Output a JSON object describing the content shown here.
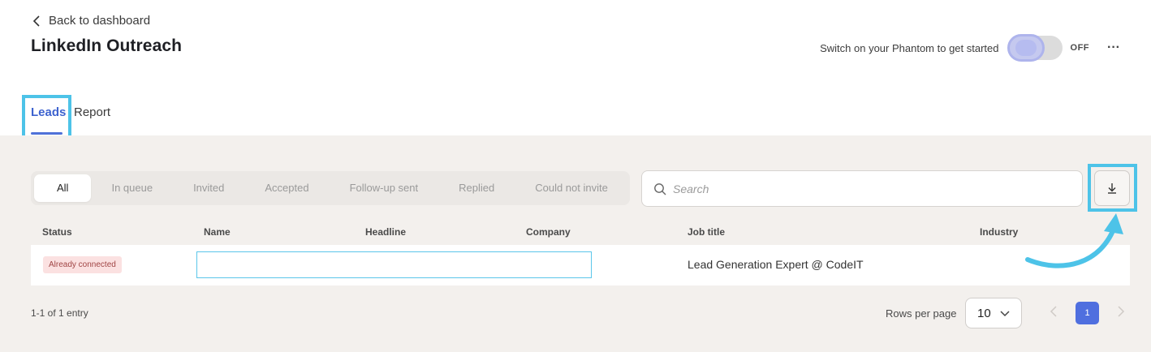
{
  "header": {
    "back_label": "Back to dashboard",
    "title": "LinkedIn Outreach",
    "switch_text": "Switch on your Phantom to get started",
    "toggle_state": "OFF",
    "more_icon": "more-horizontal-icon",
    "more_label": "···"
  },
  "tabs": [
    {
      "label": "Leads",
      "active": true
    },
    {
      "label": "Report",
      "active": false
    }
  ],
  "filters": [
    {
      "label": "All",
      "active": true
    },
    {
      "label": "In queue",
      "active": false
    },
    {
      "label": "Invited",
      "active": false
    },
    {
      "label": "Accepted",
      "active": false
    },
    {
      "label": "Follow-up sent",
      "active": false
    },
    {
      "label": "Replied",
      "active": false
    },
    {
      "label": "Could not invite",
      "active": false
    }
  ],
  "search": {
    "placeholder": "Search",
    "value": ""
  },
  "table": {
    "columns": [
      "Status",
      "Name",
      "Headline",
      "Company",
      "Job title",
      "Industry"
    ],
    "rows": [
      {
        "status": "Already connected",
        "name": "",
        "headline": "",
        "company": "",
        "job_title": "Lead Generation Expert @ CodeIT",
        "industry": ""
      }
    ]
  },
  "footer": {
    "entries": "1-1 of 1 entry",
    "rows_per_page_label": "Rows per page",
    "rows_per_page_value": "10",
    "current_page": "1"
  },
  "colors": {
    "accent": "#4f6fdf",
    "highlight": "#4dc3e8",
    "background": "#f3f0ed"
  }
}
